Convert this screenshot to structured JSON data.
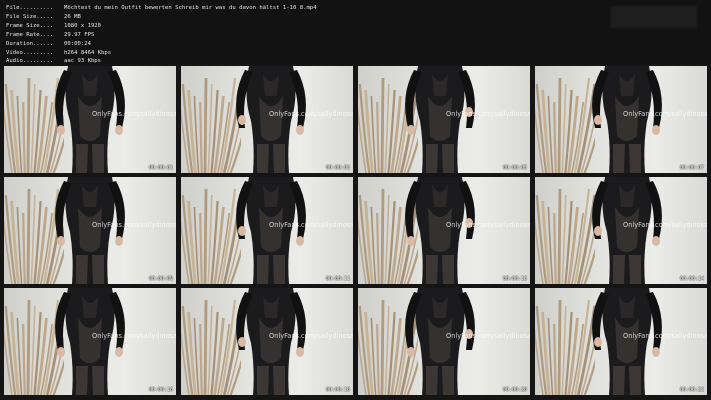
{
  "info": {
    "rows": [
      {
        "label": "File..........",
        "value": "Möchtest du mein Outfit bewerten Schreib mir was du davon hältst 1-10 8.mp4"
      },
      {
        "label": "File Size.....",
        "value": "26 MB"
      },
      {
        "label": "Frame Size....",
        "value": "1080 x 1920"
      },
      {
        "label": "Frame Rate....",
        "value": "29.97 FPS"
      },
      {
        "label": "Duration......",
        "value": "00:00:24"
      },
      {
        "label": "Video.........",
        "value": "h264 8464 Kbps"
      },
      {
        "label": "Audio.........",
        "value": "aac 93 Kbps"
      }
    ]
  },
  "watermark": "OnlyFans.com/sallydinosaur",
  "top_watermark": "BLURRED",
  "thumbnails": [
    {
      "timestamp": "00:00:01"
    },
    {
      "timestamp": "00:00:03"
    },
    {
      "timestamp": "00:00:05"
    },
    {
      "timestamp": "00:00:07"
    },
    {
      "timestamp": "00:00:09"
    },
    {
      "timestamp": "00:00:11"
    },
    {
      "timestamp": "00:00:13"
    },
    {
      "timestamp": "00:00:14"
    },
    {
      "timestamp": "00:00:16"
    },
    {
      "timestamp": "00:00:18"
    },
    {
      "timestamp": "00:00:20"
    },
    {
      "timestamp": "00:00:22"
    }
  ]
}
